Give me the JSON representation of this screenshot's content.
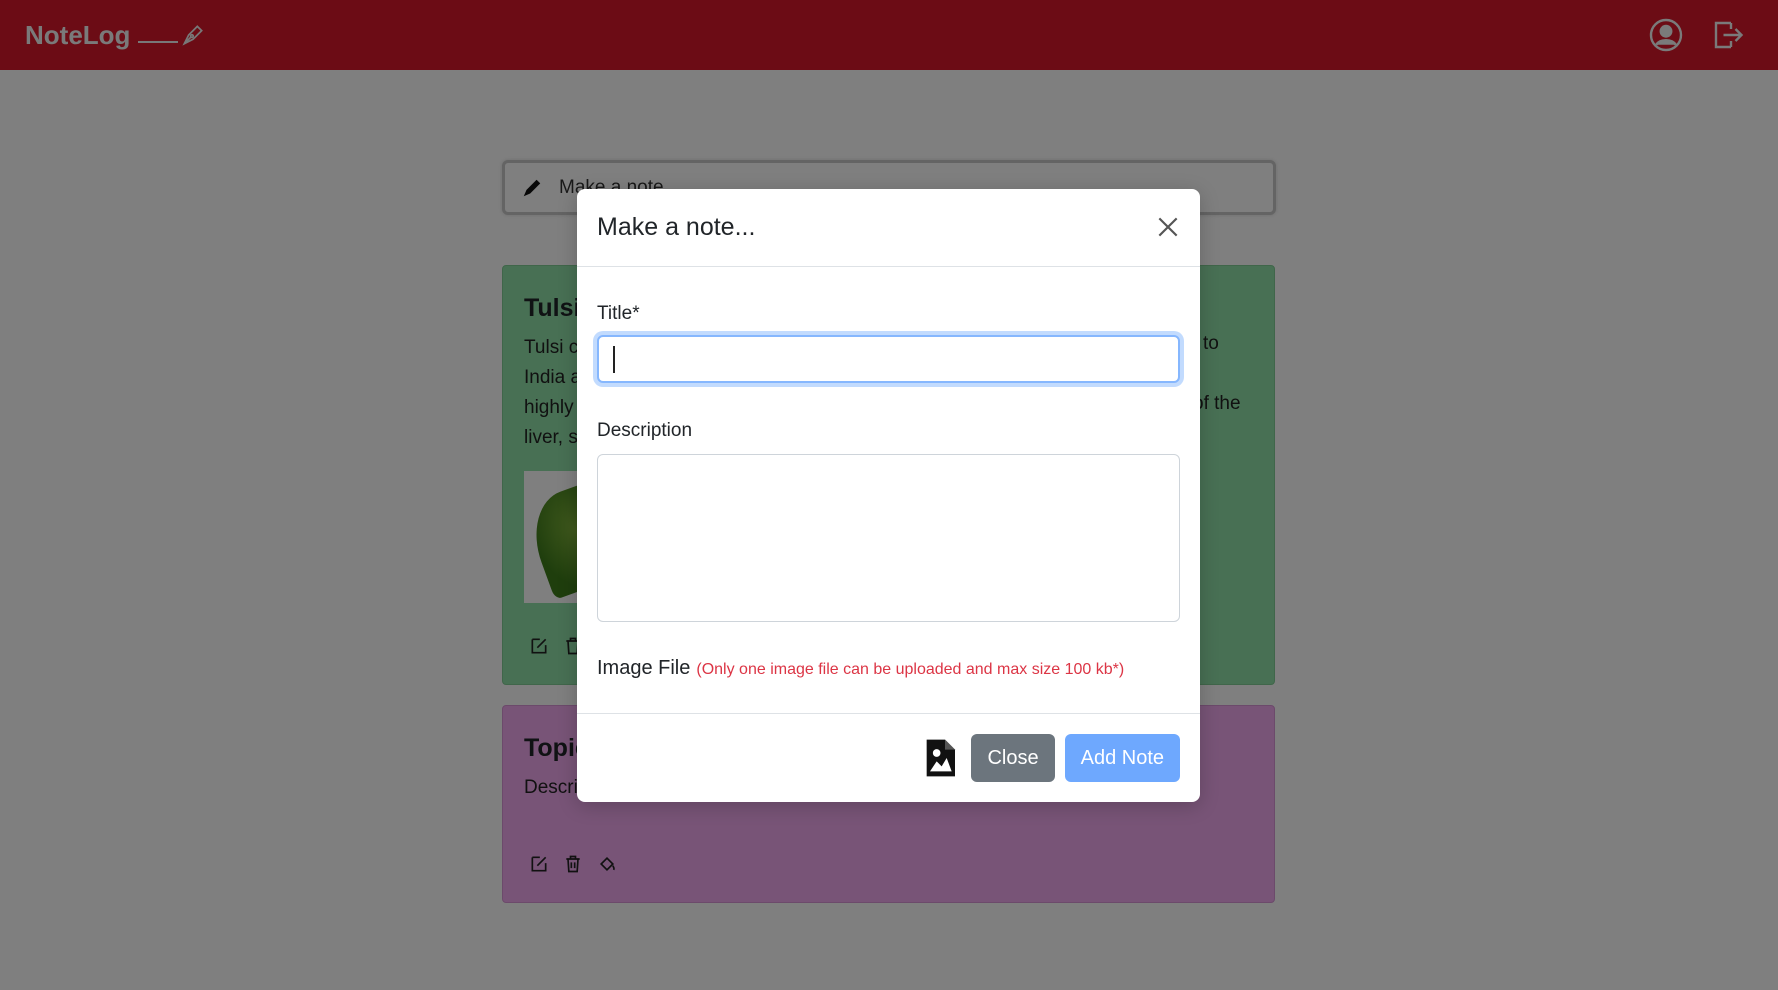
{
  "navbar": {
    "brand": "NoteLog",
    "profile_icon": "person-circle-icon",
    "logout_icon": "box-arrow-right-icon",
    "color": "#d8182a"
  },
  "make_note": {
    "placeholder": "Make a note..."
  },
  "notes": [
    {
      "title_visible": "Tulsi",
      "desc_lines_left": [
        "Tulsi c",
        "India a",
        "highly",
        "liver, s"
      ],
      "desc_lines_right": [
        "to",
        "",
        "of the",
        ""
      ],
      "color": "#90e0a8"
    },
    {
      "title_visible": "Topic",
      "desc_visible": "Descri",
      "color": "#f0a8ee"
    }
  ],
  "modal": {
    "title": "Make a note...",
    "title_label": "Title*",
    "title_value": "",
    "description_label": "Description",
    "description_value": "",
    "image_label": "Image File",
    "image_hint": "(Only one image file can be uploaded and max size 100 kb*)",
    "close_button": "Close",
    "add_button": "Add Note"
  }
}
